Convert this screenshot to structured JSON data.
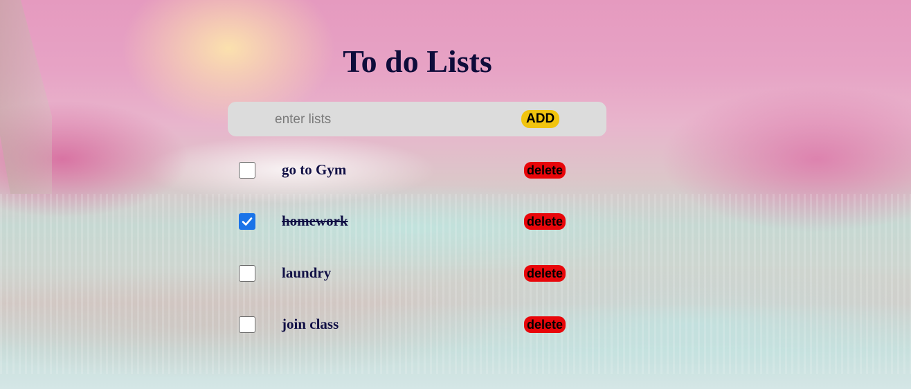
{
  "app": {
    "title": "To do Lists"
  },
  "entry": {
    "placeholder": "enter lists",
    "value": "",
    "add_label": "ADD"
  },
  "todos": [
    {
      "label": "go to Gym",
      "checked": false,
      "delete_label": "delete"
    },
    {
      "label": "homework",
      "checked": true,
      "delete_label": "delete"
    },
    {
      "label": "laundry",
      "checked": false,
      "delete_label": "delete"
    },
    {
      "label": "join class",
      "checked": false,
      "delete_label": "delete"
    }
  ],
  "colors": {
    "title": "#0e0c3a",
    "add_button": "#f1c40f",
    "delete_button": "#e8060a",
    "checkbox_checked": "#1a73e8",
    "input_bar": "#dcdcdc"
  }
}
